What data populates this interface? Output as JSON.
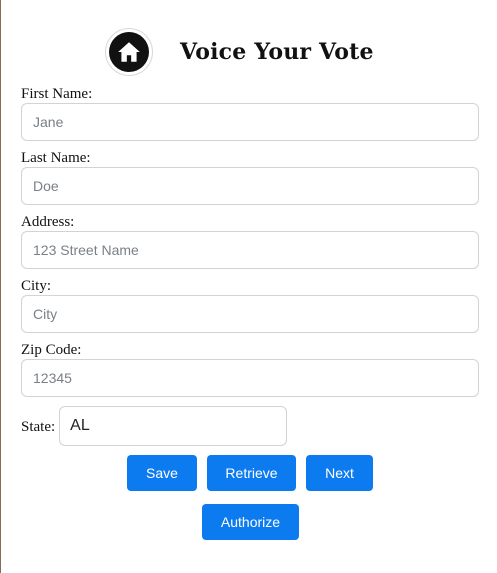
{
  "header": {
    "logo_icon": "home-icon",
    "title": "Voice Your Vote"
  },
  "form": {
    "first_name": {
      "label": "First Name:",
      "placeholder": "Jane",
      "value": ""
    },
    "last_name": {
      "label": "Last Name:",
      "placeholder": "Doe",
      "value": ""
    },
    "address": {
      "label": "Address:",
      "placeholder": "123 Street Name",
      "value": ""
    },
    "city": {
      "label": "City:",
      "placeholder": "City",
      "value": ""
    },
    "zip": {
      "label": "Zip Code:",
      "placeholder": "12345",
      "value": ""
    },
    "state": {
      "label": "State:",
      "selected": "AL"
    }
  },
  "actions": {
    "save": "Save",
    "retrieve": "Retrieve",
    "next": "Next",
    "authorize": "Authorize"
  },
  "colors": {
    "primary_button": "#0d7bf0",
    "button_text": "#ffffff",
    "input_border": "#cfd4d9"
  }
}
